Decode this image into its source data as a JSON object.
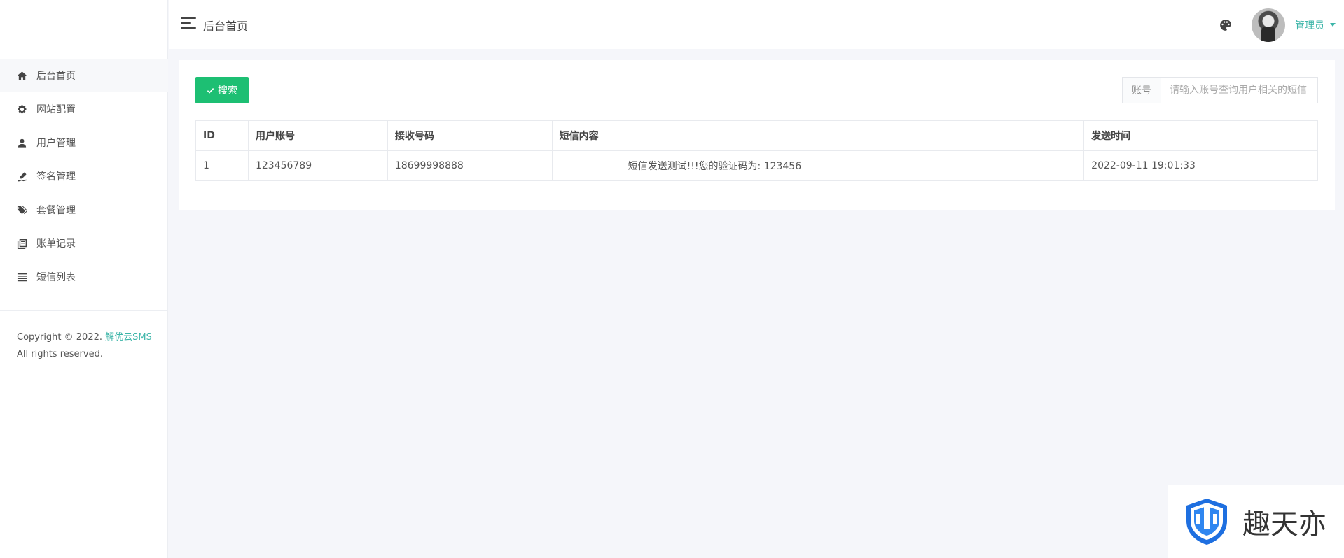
{
  "sidebar": {
    "items": [
      {
        "label": "后台首页",
        "icon": "home-icon"
      },
      {
        "label": "网站配置",
        "icon": "gear-icon"
      },
      {
        "label": "用户管理",
        "icon": "user-icon"
      },
      {
        "label": "签名管理",
        "icon": "signature-icon"
      },
      {
        "label": "套餐管理",
        "icon": "tags-icon"
      },
      {
        "label": "账单记录",
        "icon": "book-icon"
      },
      {
        "label": "短信列表",
        "icon": "list-icon"
      }
    ],
    "copyright_prefix": "Copyright © 2022.",
    "copyright_brand": "解优云SMS",
    "copyright_suffix": "All rights reserved."
  },
  "header": {
    "title": "后台首页",
    "user_name": "管理员"
  },
  "toolbar": {
    "search_label": "搜索",
    "account_label": "账号",
    "account_placeholder": "请输入账号查询用户相关的短信"
  },
  "table": {
    "columns": [
      "ID",
      "用户账号",
      "接收号码",
      "短信内容",
      "发送时间"
    ],
    "rows": [
      {
        "id": "1",
        "account": "123456789",
        "receiver": "18699998888",
        "content": "短信发送测试!!!您的验证码为: 123456",
        "time": "2022-09-11 19:01:33"
      }
    ]
  },
  "watermark": {
    "text": "趣天亦"
  },
  "colors": {
    "accent": "#3cb5a8",
    "button": "#1dbf73"
  }
}
